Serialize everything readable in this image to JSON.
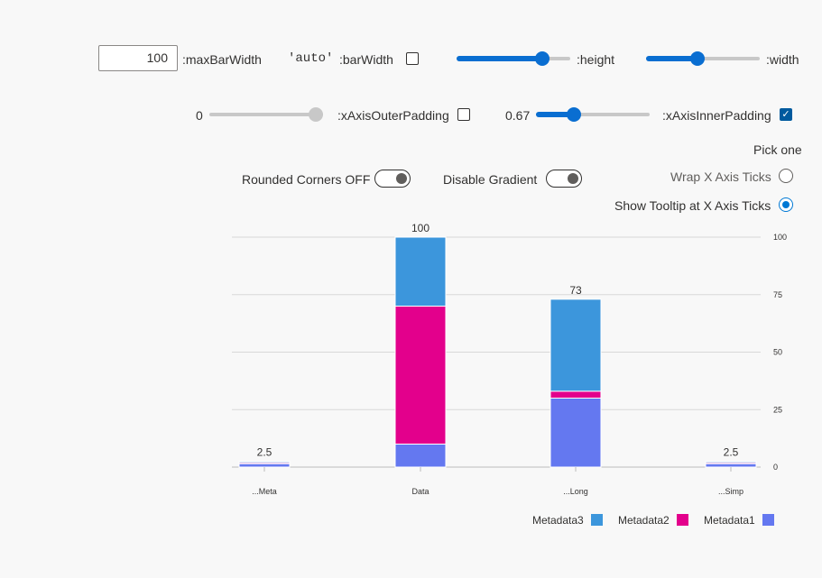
{
  "controls": {
    "max_bar_width_value": "100",
    "max_bar_width_label": ":maxBarWidth",
    "bar_width_value": "'auto'",
    "bar_width_label": ":barWidth",
    "bar_width_checked": false,
    "height_label": ":height",
    "height_value": 0.75,
    "width_label": ":width",
    "width_value": 0.45,
    "outer_padding_value": "0",
    "outer_padding_label": ":xAxisOuterPadding",
    "outer_padding_checked": false,
    "inner_padding_value": "0.67",
    "inner_padding_label": ":xAxisInnerPadding",
    "inner_padding_checked": true,
    "inner_padding_fraction": 0.33,
    "rounded_corners_label": "Rounded Corners OFF",
    "disable_gradient_label": "Disable Gradient",
    "pick_one_label": "Pick one",
    "wrap_ticks_label": "Wrap X Axis Ticks",
    "show_tooltip_label": "Show Tooltip at X Axis Ticks",
    "selected_option": "Show Tooltip at X Axis Ticks"
  },
  "chart_data": {
    "type": "bar",
    "stacked": true,
    "categories": [
      "...Meta",
      "Data",
      "...Long",
      "...Simp"
    ],
    "totals_labels": [
      "2.5",
      "100",
      "73",
      "2.5"
    ],
    "series": [
      {
        "name": "Metadata1",
        "color": "#6478f0",
        "values": [
          1.5,
          10,
          30,
          1.5
        ]
      },
      {
        "name": "Metadata2",
        "color": "#e3008c",
        "values": [
          0.5,
          60,
          3,
          0.5
        ]
      },
      {
        "name": "Metadata3",
        "color": "#3c96dc",
        "values": [
          0.5,
          30,
          40,
          0.5
        ]
      }
    ],
    "yticks": [
      "0",
      "25",
      "50",
      "75",
      "100"
    ],
    "ylim": [
      0,
      100
    ],
    "legend": [
      "Metadata3",
      "Metadata2",
      "Metadata1"
    ],
    "legend_position": "bottom-right",
    "grid": true
  }
}
